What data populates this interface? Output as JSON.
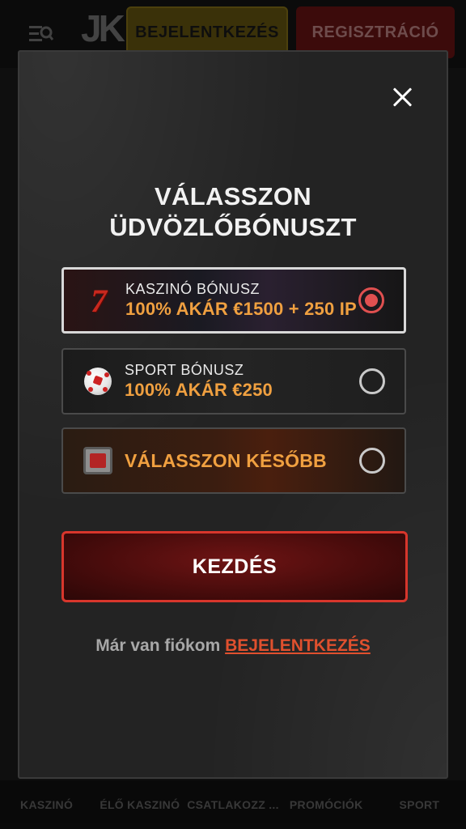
{
  "header": {
    "logo": "JK",
    "login_label": "BEJELENTKEZÉS",
    "register_label": "REGISZTRÁCIÓ"
  },
  "bottom_nav": {
    "items": [
      "KASZINÓ",
      "ÉLŐ KASZINÓ",
      "CSATLAKOZZ ...",
      "PROMÓCIÓK",
      "SPORT"
    ]
  },
  "modal": {
    "title_line1": "VÁLASSZON",
    "title_line2": "ÜDVÖZLŐBÓNUSZT",
    "options": [
      {
        "label": "KASZINÓ BÓNUSZ",
        "value": "100% AKÁR €1500 + 250 IP",
        "icon": "seven-icon",
        "selected": true
      },
      {
        "label": "SPORT BÓNUSZ",
        "value": "100% AKÁR €250",
        "icon": "soccer-ball-icon",
        "selected": false
      },
      {
        "label": "",
        "value": "VÁLASSZON KÉSŐBB",
        "icon": "clock-icon",
        "selected": false
      }
    ],
    "start_label": "KEZDÉS",
    "footer_text": "Már van fiókom",
    "footer_link": "BEJELENTKEZÉS"
  },
  "colors": {
    "accent_orange": "#f0a040",
    "accent_red": "#d8362c",
    "link_color": "#e0502e"
  }
}
